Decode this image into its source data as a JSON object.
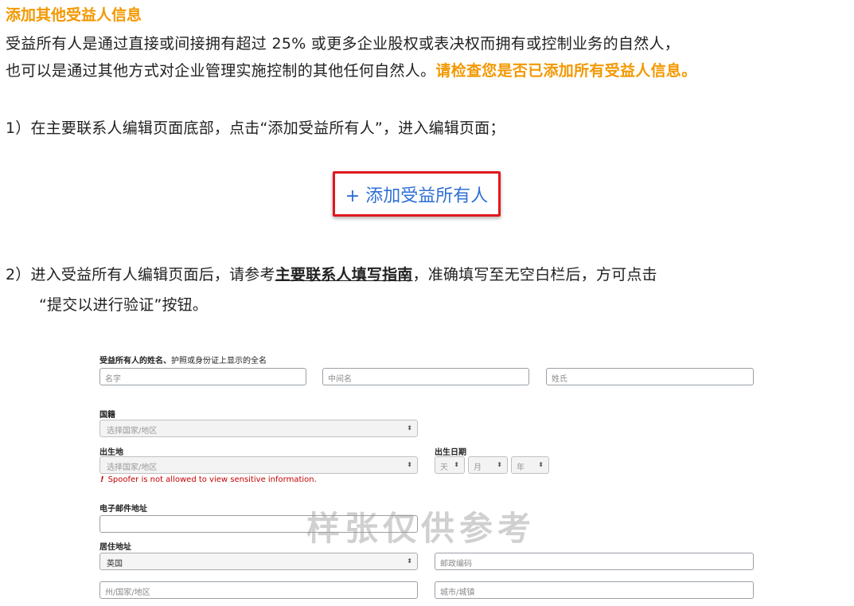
{
  "section_title": "添加其他受益人信息",
  "intro": {
    "line1": "受益所有人是通过直接或间接拥有超过 25% 或更多企业股权或表决权而拥有或控制业务的自然人，",
    "line2_plain": "也可以是通过其他方式对企业管理实施控制的其他任何自然人。",
    "line2_highlight": "请检查您是否已添加所有受益人信息。"
  },
  "step1": "1）在主要联系人编辑页面底部，点击“添加受益所有人”，进入编辑页面；",
  "add_button_label": "+ 添加受益所有人",
  "step2": {
    "prefix": "2）进入受益所有人编辑页面后，请参考",
    "link": "主要联系人填写指南",
    "suffix": "，准确填写至无空白栏后，方可点击",
    "line2": "“提交以进行验证”按钮。"
  },
  "form": {
    "name_label_bold": "受益所有人的姓名、",
    "name_label_rest": "护照或身份证上显示的全名",
    "first_name_placeholder": "名字",
    "middle_name_placeholder": "中间名",
    "last_name_placeholder": "姓氏",
    "nationality_label": "国籍",
    "nationality_value": "选择国家/地区",
    "birthplace_label": "出生地",
    "birthplace_value": "选择国家/地区",
    "birthdate_label": "出生日期",
    "day": "天",
    "month": "月",
    "year": "年",
    "error_icon": "!",
    "error_text": "Spoofer is not allowed to view sensitive information.",
    "email_label": "电子邮件地址",
    "email_value": "",
    "address_label": "居住地址",
    "country_value": "英国",
    "postal_placeholder": "邮政编码",
    "state_placeholder": "州/国家/地区",
    "city_placeholder": "城市/城镇",
    "select_arrow": "⬍"
  },
  "watermark": "样张仅供参考",
  "colors": {
    "accent_orange": "#f39800",
    "highlight_red": "#e0191e",
    "link_blue": "#2f6fd6"
  }
}
